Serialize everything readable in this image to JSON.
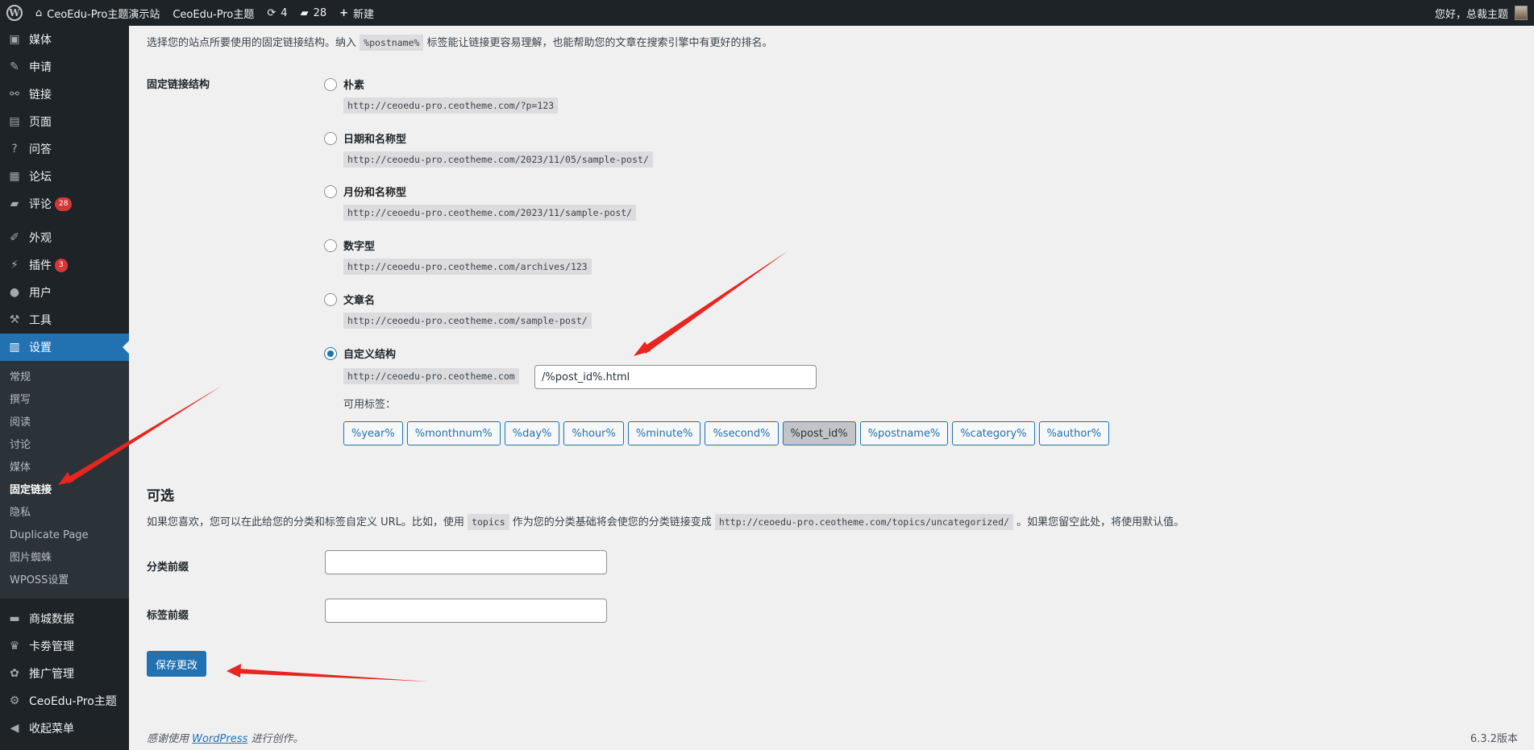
{
  "adminbar": {
    "site_name": "CeoEdu-Pro主题演示站",
    "theme_link": "CeoEdu-Pro主题",
    "updates_count": "4",
    "comments_count": "28",
    "new_label": "新建",
    "greeting": "您好，总裁主题"
  },
  "sidebar": {
    "items_top": [
      {
        "label": "媒体",
        "icon": "media-icon"
      },
      {
        "label": "申请",
        "icon": "edit-icon"
      },
      {
        "label": "链接",
        "icon": "link-icon"
      },
      {
        "label": "页面",
        "icon": "page-icon"
      },
      {
        "label": "问答",
        "icon": "question-icon"
      },
      {
        "label": "论坛",
        "icon": "forum-icon"
      },
      {
        "label": "评论",
        "icon": "comment-icon",
        "badge": "28"
      }
    ],
    "items_mid": [
      {
        "label": "外观",
        "icon": "brush-icon"
      },
      {
        "label": "插件",
        "icon": "plugin-icon",
        "badge": "3"
      },
      {
        "label": "用户",
        "icon": "user-icon"
      },
      {
        "label": "工具",
        "icon": "wrench-icon"
      },
      {
        "label": "设置",
        "icon": "settings-icon"
      }
    ],
    "submenu": [
      "常规",
      "撰写",
      "阅读",
      "讨论",
      "媒体",
      "固定链接",
      "隐私",
      "Duplicate Page",
      "图片蜘蛛",
      "WPOSS设置"
    ],
    "items_bottom": [
      {
        "label": "商城数据",
        "icon": "store-icon"
      },
      {
        "label": "卡劵管理",
        "icon": "card-icon"
      },
      {
        "label": "推广管理",
        "icon": "promo-icon"
      },
      {
        "label": "CeoEdu-Pro主题",
        "icon": "gear-icon"
      },
      {
        "label": "收起菜单",
        "icon": "collapse-icon"
      }
    ]
  },
  "main": {
    "intro_before": "选择您的站点所要使用的固定链接结构。纳入",
    "intro_code": "%postname%",
    "intro_after": "标签能让链接更容易理解，也能帮助您的文章在搜索引擎中有更好的排名。",
    "structure_label": "固定链接结构",
    "options": [
      {
        "label": "朴素",
        "example": "http://ceoedu-pro.ceotheme.com/?p=123"
      },
      {
        "label": "日期和名称型",
        "example": "http://ceoedu-pro.ceotheme.com/2023/11/05/sample-post/"
      },
      {
        "label": "月份和名称型",
        "example": "http://ceoedu-pro.ceotheme.com/2023/11/sample-post/"
      },
      {
        "label": "数字型",
        "example": "http://ceoedu-pro.ceotheme.com/archives/123"
      },
      {
        "label": "文章名",
        "example": "http://ceoedu-pro.ceotheme.com/sample-post/"
      },
      {
        "label": "自定义结构",
        "example": "http://ceoedu-pro.ceotheme.com"
      }
    ],
    "custom_value": "/%post_id%.html",
    "available_tags_label": "可用标签：",
    "tags": [
      "%year%",
      "%monthnum%",
      "%day%",
      "%hour%",
      "%minute%",
      "%second%",
      "%post_id%",
      "%postname%",
      "%category%",
      "%author%"
    ],
    "optional_title": "可选",
    "optional_desc_1": "如果您喜欢，您可以在此给您的分类和标签自定义 URL。比如，使用",
    "optional_code_1": "topics",
    "optional_desc_2": "作为您的分类基础将会使您的分类链接变成",
    "optional_code_2": "http://ceoedu-pro.ceotheme.com/topics/uncategorized/",
    "optional_desc_3": "。如果您留空此处，将使用默认值。",
    "category_base_label": "分类前缀",
    "tag_base_label": "标签前缀",
    "category_base_value": "",
    "tag_base_value": "",
    "save_label": "保存更改"
  },
  "footer": {
    "thanks_before": "感谢使用",
    "thanks_link": "WordPress",
    "thanks_after": "进行创作。",
    "version": "6.3.2版本"
  },
  "colors": {
    "accent": "#2271b1",
    "sidebar_bg": "#1d2327",
    "badge": "#d63638",
    "annotation_arrow": "#e8251f"
  }
}
